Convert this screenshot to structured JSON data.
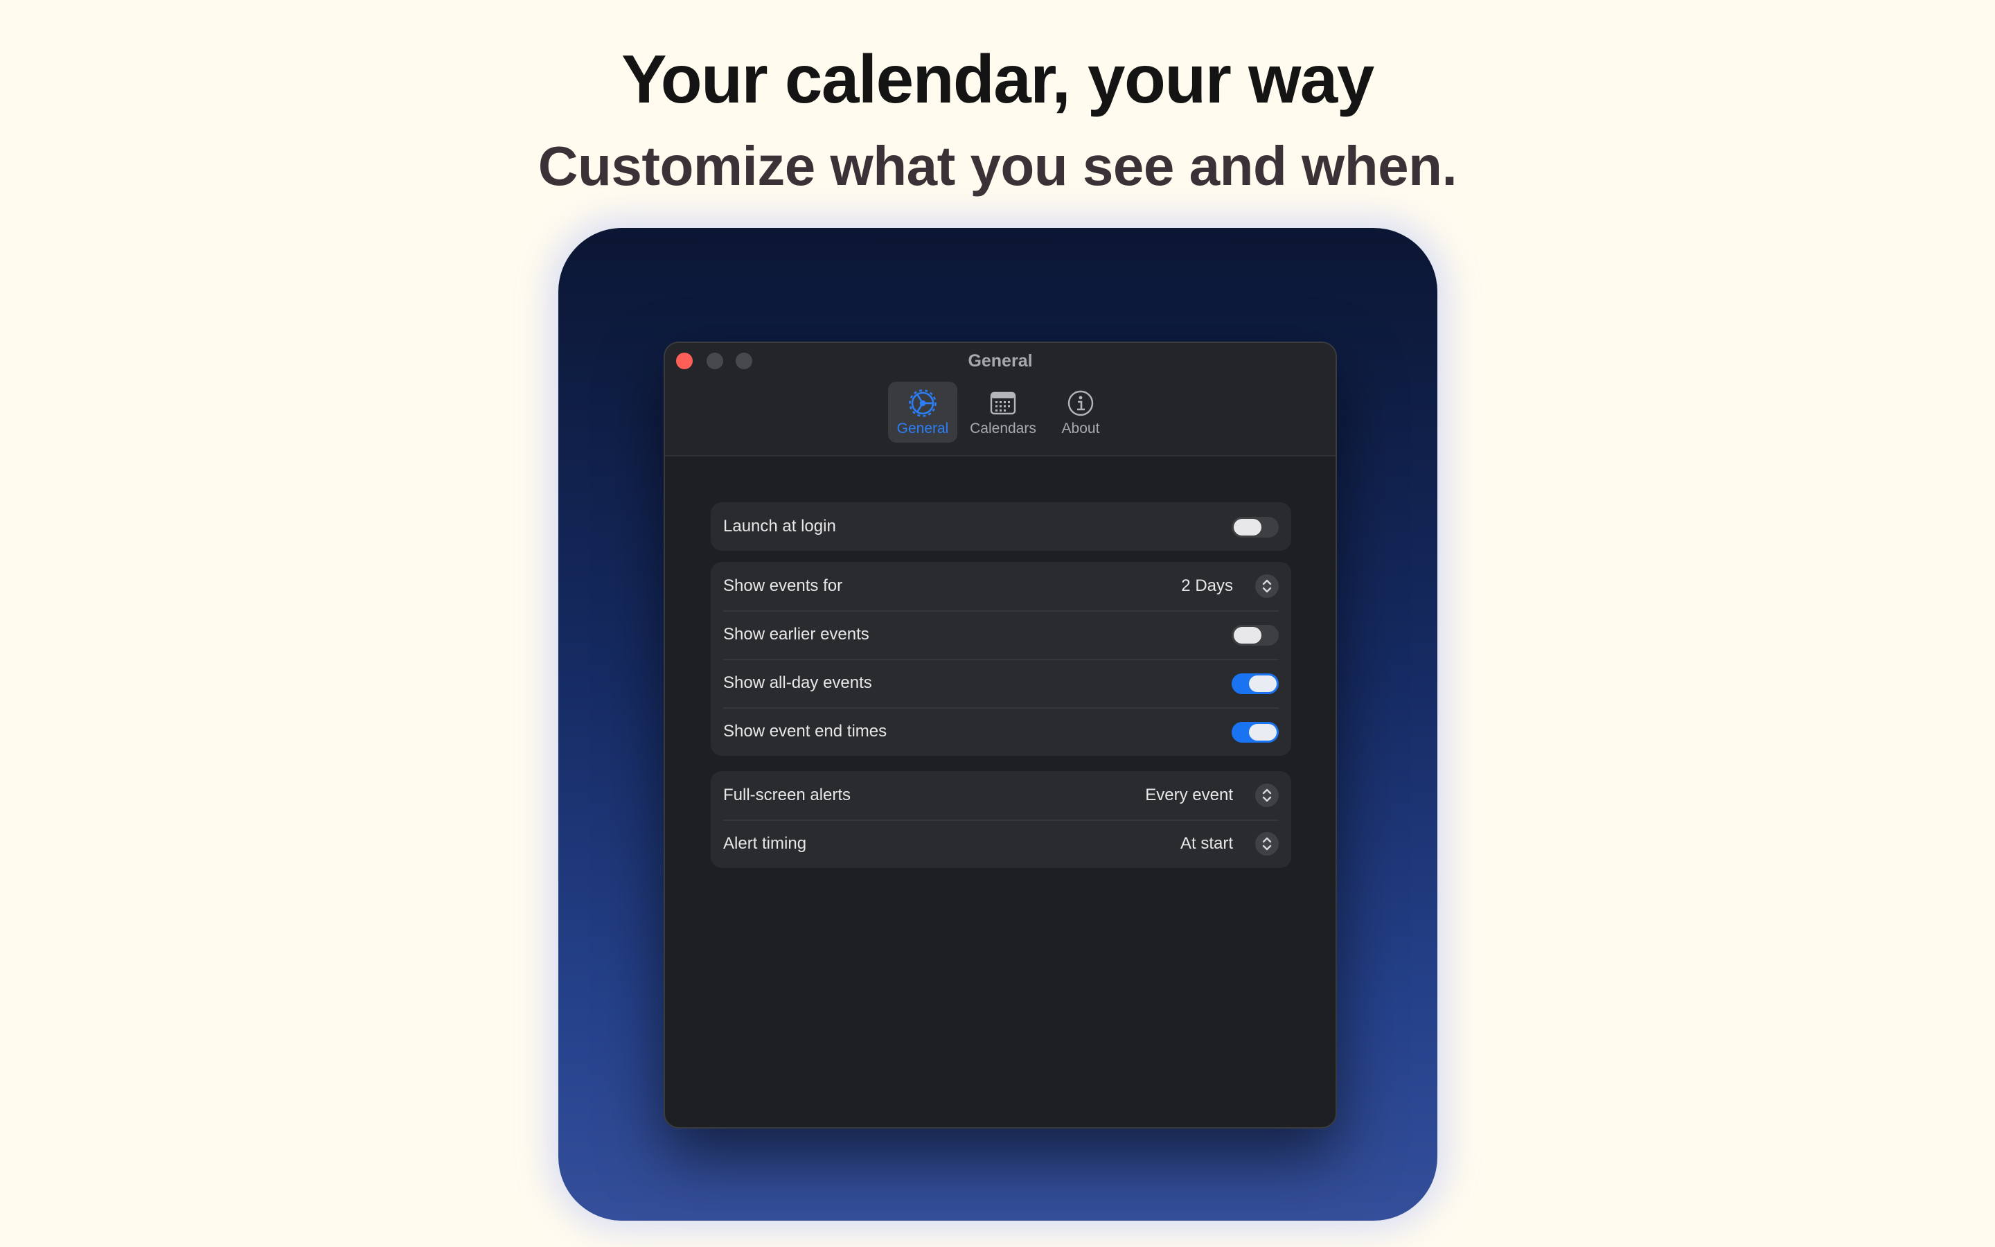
{
  "hero": {
    "headline": "Your calendar, your way",
    "subheadline": "Customize what you see and when."
  },
  "window": {
    "title": "General",
    "tabs": [
      {
        "label": "General",
        "icon": "gear-icon",
        "active": true
      },
      {
        "label": "Calendars",
        "icon": "calendar-icon",
        "active": false
      },
      {
        "label": "About",
        "icon": "info-icon",
        "active": false
      }
    ]
  },
  "settings": {
    "launch_at_login": {
      "label": "Launch at login",
      "on": false
    },
    "show_events_for": {
      "label": "Show events for",
      "value": "2 Days"
    },
    "show_earlier_events": {
      "label": "Show earlier events",
      "on": false
    },
    "show_all_day_events": {
      "label": "Show all-day events",
      "on": true
    },
    "show_event_end_times": {
      "label": "Show event end times",
      "on": true
    },
    "full_screen_alerts": {
      "label": "Full-screen alerts",
      "value": "Every event"
    },
    "alert_timing": {
      "label": "Alert timing",
      "value": "At start"
    }
  },
  "colors": {
    "accent": "#2b7ef6",
    "toggle_on": "#1a73f0",
    "close_button": "#ff5f57",
    "page_background": "#fffbef"
  }
}
